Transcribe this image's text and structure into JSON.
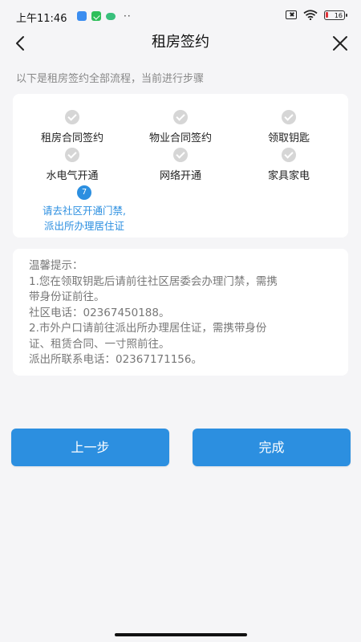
{
  "status_bar": {
    "time": "上午11:46",
    "dots": "··",
    "battery": "16"
  },
  "nav": {
    "title": "租房签约"
  },
  "intro": "以下是租房签约全部流程，当前进行步骤",
  "steps": [
    {
      "label": "租房合同签约",
      "done": true
    },
    {
      "label": "物业合同签约",
      "done": true
    },
    {
      "label": "领取钥匙",
      "done": true
    },
    {
      "label": "水电气开通",
      "done": true
    },
    {
      "label": "网络开通",
      "done": true
    },
    {
      "label": "家具家电",
      "done": true
    }
  ],
  "current_step": {
    "number": "7",
    "line1": "请去社区开通门禁,",
    "line2": "派出所办理居住证"
  },
  "tips": {
    "lines": [
      "温馨提示：",
      "1.您在领取钥匙后请前往社区居委会办理门禁，需携",
      "带身份证前往。",
      "社区电话：02367450188。",
      "2.市外户口请前往派出所办理居住证，需携带身份",
      "证、租赁合同、一寸照前往。",
      "派出所联系电话：02367171156。"
    ]
  },
  "buttons": {
    "prev": "上一步",
    "done": "完成"
  },
  "colors": {
    "accent": "#2c8fe0",
    "background": "#f5f5f7",
    "done_check": "#d6d6d6"
  }
}
